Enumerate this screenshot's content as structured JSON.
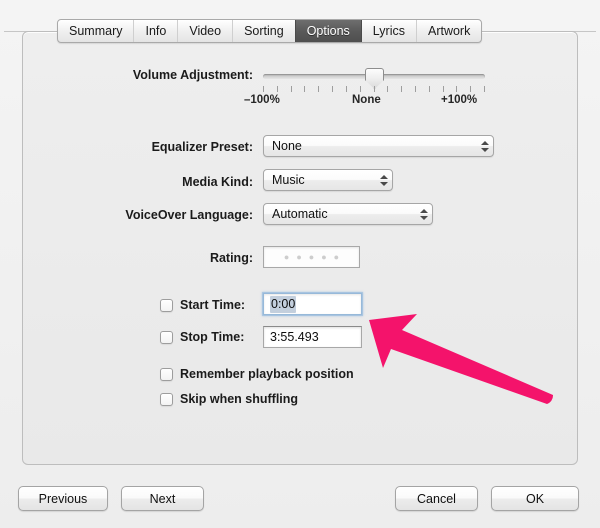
{
  "dialog": {
    "tabs": [
      {
        "label": "Summary",
        "selected": false
      },
      {
        "label": "Info",
        "selected": false
      },
      {
        "label": "Video",
        "selected": false
      },
      {
        "label": "Sorting",
        "selected": false
      },
      {
        "label": "Options",
        "selected": true
      },
      {
        "label": "Lyrics",
        "selected": false
      },
      {
        "label": "Artwork",
        "selected": false
      }
    ],
    "volume": {
      "label": "Volume Adjustment:",
      "value": "None",
      "min_label": "–100%",
      "mid_label": "None",
      "max_label": "+100%",
      "tick_count": 17,
      "knob_percent": 50
    },
    "fields": {
      "equalizer": {
        "label": "Equalizer Preset:",
        "value": "None"
      },
      "media_kind": {
        "label": "Media Kind:",
        "value": "Music"
      },
      "voiceover": {
        "label": "VoiceOver Language:",
        "value": "Automatic"
      },
      "rating": {
        "label": "Rating:",
        "stars": 5,
        "value": ""
      },
      "start_time": {
        "label": "Start Time:",
        "value": "0:00",
        "checked": false,
        "focused": true
      },
      "stop_time": {
        "label": "Stop Time:",
        "value": "3:55.493",
        "checked": false,
        "focused": false
      }
    },
    "checkboxes": [
      {
        "label": "Remember playback position",
        "checked": false
      },
      {
        "label": "Skip when shuffling",
        "checked": false
      }
    ],
    "buttons": {
      "previous": "Previous",
      "next": "Next",
      "cancel": "Cancel",
      "ok": "OK"
    }
  },
  "annotation": {
    "arrow_color": "#f4136b",
    "points_to": "start-time-field"
  }
}
